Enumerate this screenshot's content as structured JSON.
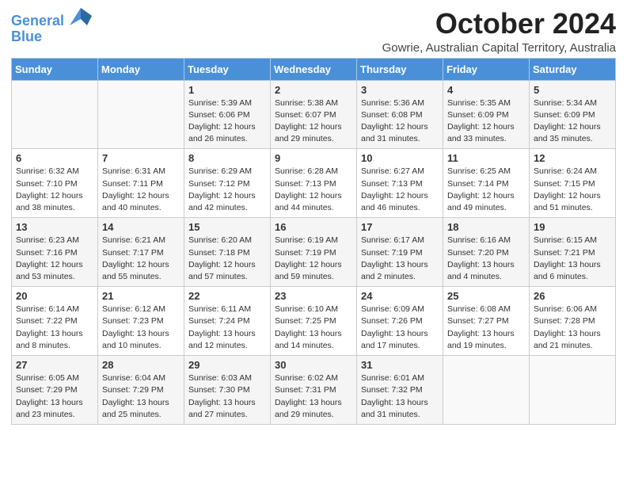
{
  "header": {
    "logo_line1": "General",
    "logo_line2": "Blue",
    "month": "October 2024",
    "location": "Gowrie, Australian Capital Territory, Australia"
  },
  "days_of_week": [
    "Sunday",
    "Monday",
    "Tuesday",
    "Wednesday",
    "Thursday",
    "Friday",
    "Saturday"
  ],
  "weeks": [
    [
      {
        "day": "",
        "detail": ""
      },
      {
        "day": "",
        "detail": ""
      },
      {
        "day": "1",
        "detail": "Sunrise: 5:39 AM\nSunset: 6:06 PM\nDaylight: 12 hours\nand 26 minutes."
      },
      {
        "day": "2",
        "detail": "Sunrise: 5:38 AM\nSunset: 6:07 PM\nDaylight: 12 hours\nand 29 minutes."
      },
      {
        "day": "3",
        "detail": "Sunrise: 5:36 AM\nSunset: 6:08 PM\nDaylight: 12 hours\nand 31 minutes."
      },
      {
        "day": "4",
        "detail": "Sunrise: 5:35 AM\nSunset: 6:09 PM\nDaylight: 12 hours\nand 33 minutes."
      },
      {
        "day": "5",
        "detail": "Sunrise: 5:34 AM\nSunset: 6:09 PM\nDaylight: 12 hours\nand 35 minutes."
      }
    ],
    [
      {
        "day": "6",
        "detail": "Sunrise: 6:32 AM\nSunset: 7:10 PM\nDaylight: 12 hours\nand 38 minutes."
      },
      {
        "day": "7",
        "detail": "Sunrise: 6:31 AM\nSunset: 7:11 PM\nDaylight: 12 hours\nand 40 minutes."
      },
      {
        "day": "8",
        "detail": "Sunrise: 6:29 AM\nSunset: 7:12 PM\nDaylight: 12 hours\nand 42 minutes."
      },
      {
        "day": "9",
        "detail": "Sunrise: 6:28 AM\nSunset: 7:13 PM\nDaylight: 12 hours\nand 44 minutes."
      },
      {
        "day": "10",
        "detail": "Sunrise: 6:27 AM\nSunset: 7:13 PM\nDaylight: 12 hours\nand 46 minutes."
      },
      {
        "day": "11",
        "detail": "Sunrise: 6:25 AM\nSunset: 7:14 PM\nDaylight: 12 hours\nand 49 minutes."
      },
      {
        "day": "12",
        "detail": "Sunrise: 6:24 AM\nSunset: 7:15 PM\nDaylight: 12 hours\nand 51 minutes."
      }
    ],
    [
      {
        "day": "13",
        "detail": "Sunrise: 6:23 AM\nSunset: 7:16 PM\nDaylight: 12 hours\nand 53 minutes."
      },
      {
        "day": "14",
        "detail": "Sunrise: 6:21 AM\nSunset: 7:17 PM\nDaylight: 12 hours\nand 55 minutes."
      },
      {
        "day": "15",
        "detail": "Sunrise: 6:20 AM\nSunset: 7:18 PM\nDaylight: 12 hours\nand 57 minutes."
      },
      {
        "day": "16",
        "detail": "Sunrise: 6:19 AM\nSunset: 7:19 PM\nDaylight: 12 hours\nand 59 minutes."
      },
      {
        "day": "17",
        "detail": "Sunrise: 6:17 AM\nSunset: 7:19 PM\nDaylight: 13 hours\nand 2 minutes."
      },
      {
        "day": "18",
        "detail": "Sunrise: 6:16 AM\nSunset: 7:20 PM\nDaylight: 13 hours\nand 4 minutes."
      },
      {
        "day": "19",
        "detail": "Sunrise: 6:15 AM\nSunset: 7:21 PM\nDaylight: 13 hours\nand 6 minutes."
      }
    ],
    [
      {
        "day": "20",
        "detail": "Sunrise: 6:14 AM\nSunset: 7:22 PM\nDaylight: 13 hours\nand 8 minutes."
      },
      {
        "day": "21",
        "detail": "Sunrise: 6:12 AM\nSunset: 7:23 PM\nDaylight: 13 hours\nand 10 minutes."
      },
      {
        "day": "22",
        "detail": "Sunrise: 6:11 AM\nSunset: 7:24 PM\nDaylight: 13 hours\nand 12 minutes."
      },
      {
        "day": "23",
        "detail": "Sunrise: 6:10 AM\nSunset: 7:25 PM\nDaylight: 13 hours\nand 14 minutes."
      },
      {
        "day": "24",
        "detail": "Sunrise: 6:09 AM\nSunset: 7:26 PM\nDaylight: 13 hours\nand 17 minutes."
      },
      {
        "day": "25",
        "detail": "Sunrise: 6:08 AM\nSunset: 7:27 PM\nDaylight: 13 hours\nand 19 minutes."
      },
      {
        "day": "26",
        "detail": "Sunrise: 6:06 AM\nSunset: 7:28 PM\nDaylight: 13 hours\nand 21 minutes."
      }
    ],
    [
      {
        "day": "27",
        "detail": "Sunrise: 6:05 AM\nSunset: 7:29 PM\nDaylight: 13 hours\nand 23 minutes."
      },
      {
        "day": "28",
        "detail": "Sunrise: 6:04 AM\nSunset: 7:29 PM\nDaylight: 13 hours\nand 25 minutes."
      },
      {
        "day": "29",
        "detail": "Sunrise: 6:03 AM\nSunset: 7:30 PM\nDaylight: 13 hours\nand 27 minutes."
      },
      {
        "day": "30",
        "detail": "Sunrise: 6:02 AM\nSunset: 7:31 PM\nDaylight: 13 hours\nand 29 minutes."
      },
      {
        "day": "31",
        "detail": "Sunrise: 6:01 AM\nSunset: 7:32 PM\nDaylight: 13 hours\nand 31 minutes."
      },
      {
        "day": "",
        "detail": ""
      },
      {
        "day": "",
        "detail": ""
      }
    ]
  ]
}
